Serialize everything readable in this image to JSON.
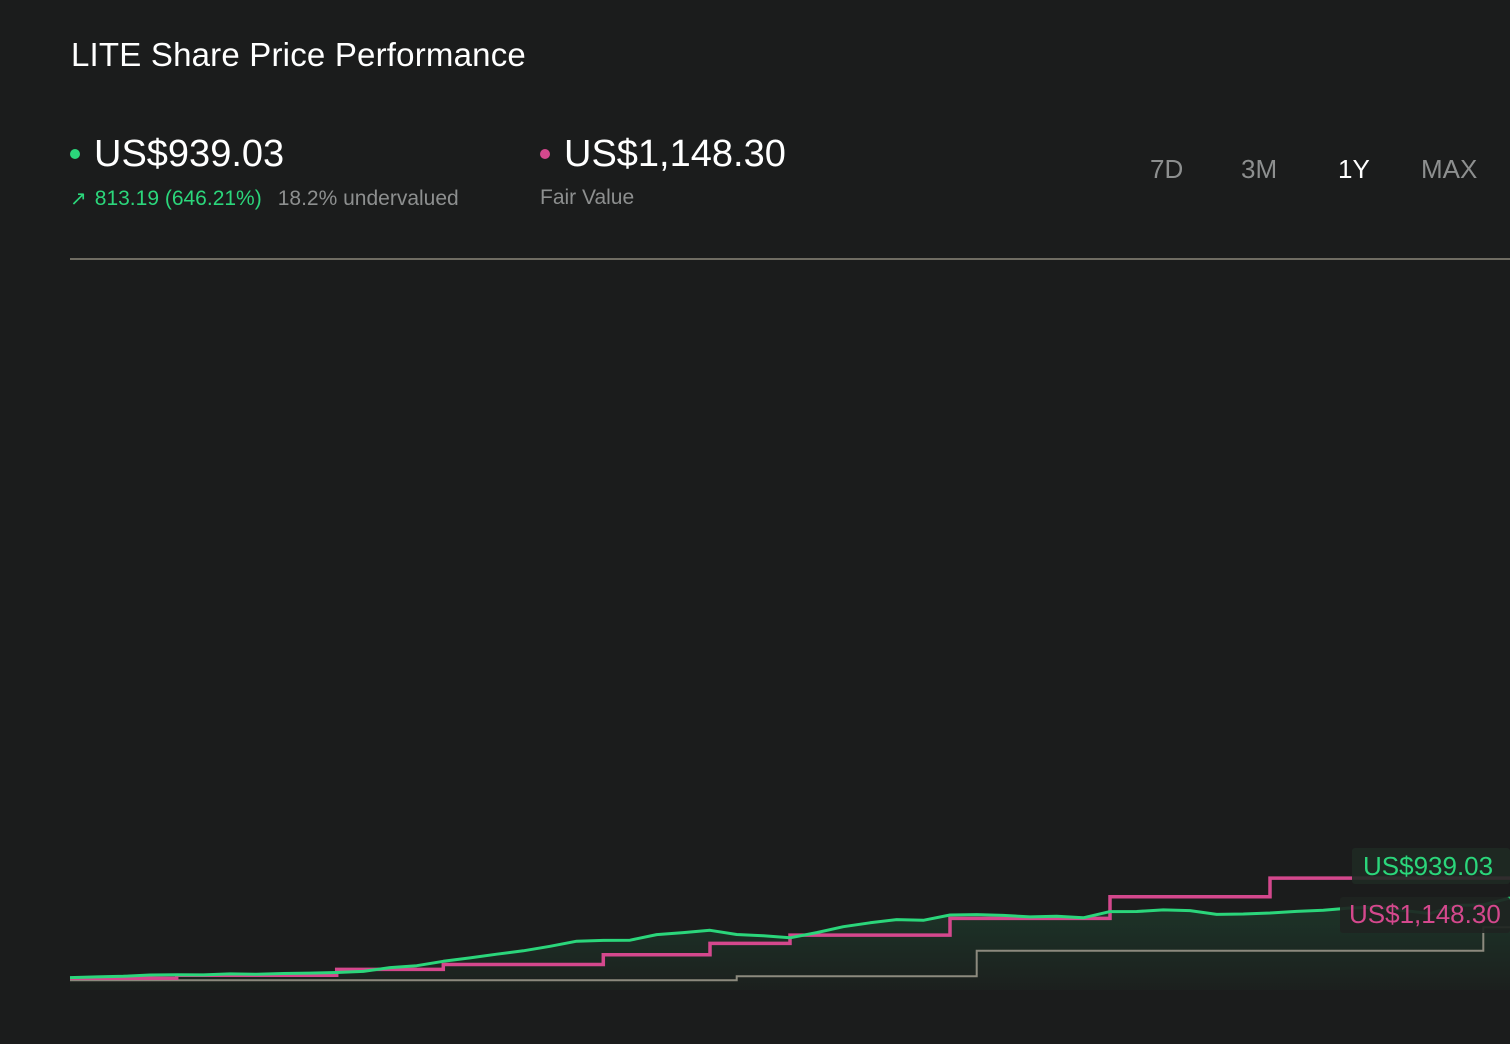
{
  "title": "LITE Share Price Performance",
  "price": {
    "value": "US$939.03",
    "change": "813.19 (646.21%)",
    "valuation": "18.2% undervalued",
    "change_icon": "arrow-up-right-icon"
  },
  "fair_value": {
    "value": "US$1,148.30",
    "label": "Fair Value"
  },
  "ranges": [
    {
      "label": "7D",
      "active": false
    },
    {
      "label": "3M",
      "active": false
    },
    {
      "label": "1Y",
      "active": true
    },
    {
      "label": "MAX",
      "active": false
    }
  ],
  "colors": {
    "price": "#2bd67b",
    "fair_value": "#d4488d",
    "analyst": "#8c8a7e",
    "muted": "#8d8f8f",
    "background": "#1b1c1c"
  },
  "chart_data": {
    "type": "line",
    "ylim": [
      0,
      7450
    ],
    "grid": false,
    "series": [
      {
        "key": "price",
        "values": [
          126,
          133,
          140,
          153,
          156,
          154,
          164,
          160,
          168,
          172,
          178,
          190,
          228,
          248,
          292,
          327,
          365,
          400,
          445,
          497,
          506,
          508,
          565,
          585,
          608,
          566,
          552,
          532,
          585,
          645,
          685,
          717,
          710,
          764,
          768,
          760,
          745,
          752,
          736,
          799,
          800,
          816,
          809,
          770,
          775,
          785,
          801,
          812,
          836,
          845,
          810,
          780,
          862,
          867,
          939
        ]
      },
      {
        "key": "fair_value",
        "values": [
          120,
          120,
          120,
          120,
          150,
          150,
          150,
          150,
          150,
          150,
          210,
          210,
          210,
          210,
          260,
          260,
          260,
          260,
          260,
          260,
          360,
          360,
          360,
          360,
          475,
          475,
          475,
          560,
          560,
          560,
          560,
          560,
          560,
          730,
          730,
          730,
          730,
          730,
          730,
          950,
          950,
          950,
          950,
          950,
          950,
          1140,
          1140,
          1140,
          1140,
          1140,
          1140,
          1140,
          1140,
          1140,
          1148.3
        ]
      },
      {
        "key": "analyst_target",
        "values": [
          100,
          100,
          100,
          100,
          100,
          100,
          100,
          100,
          100,
          100,
          100,
          100,
          100,
          100,
          100,
          100,
          100,
          100,
          100,
          100,
          100,
          100,
          100,
          100,
          100,
          140,
          140,
          140,
          140,
          140,
          140,
          140,
          140,
          140,
          400,
          400,
          400,
          400,
          400,
          400,
          400,
          400,
          400,
          400,
          400,
          400,
          400,
          400,
          400,
          400,
          400,
          400,
          400,
          640,
          640
        ]
      }
    ],
    "end_labels": [
      {
        "series": "price",
        "text": "US$939.03"
      },
      {
        "series": "fair_value",
        "text": "US$1,148.30"
      }
    ]
  }
}
